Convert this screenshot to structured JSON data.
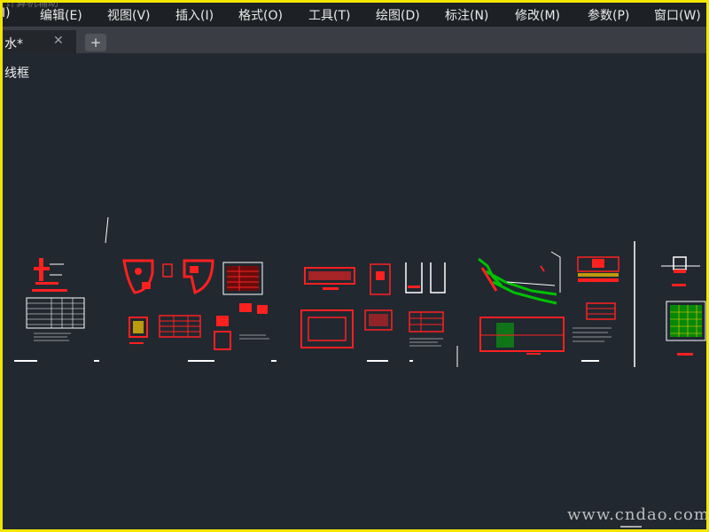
{
  "app": {
    "ghost_title": "计算机辅助"
  },
  "menubar": {
    "items": [
      {
        "label": "I)"
      },
      {
        "label": "编辑(E)"
      },
      {
        "label": "视图(V)"
      },
      {
        "label": "插入(I)"
      },
      {
        "label": "格式(O)"
      },
      {
        "label": "工具(T)"
      },
      {
        "label": "绘图(D)"
      },
      {
        "label": "标注(N)"
      },
      {
        "label": "修改(M)"
      },
      {
        "label": "参数(P)"
      },
      {
        "label": "窗口(W)"
      }
    ]
  },
  "tabs": {
    "active_title": "水*",
    "close_glyph": "✕",
    "add_glyph": "+"
  },
  "viewport": {
    "label": "线框"
  },
  "watermark": {
    "text": "www.cndao.com"
  },
  "colors": {
    "background": "#212830",
    "frame": "#f2e600",
    "drawing_red": "#ff2020",
    "drawing_green": "#00c000"
  }
}
